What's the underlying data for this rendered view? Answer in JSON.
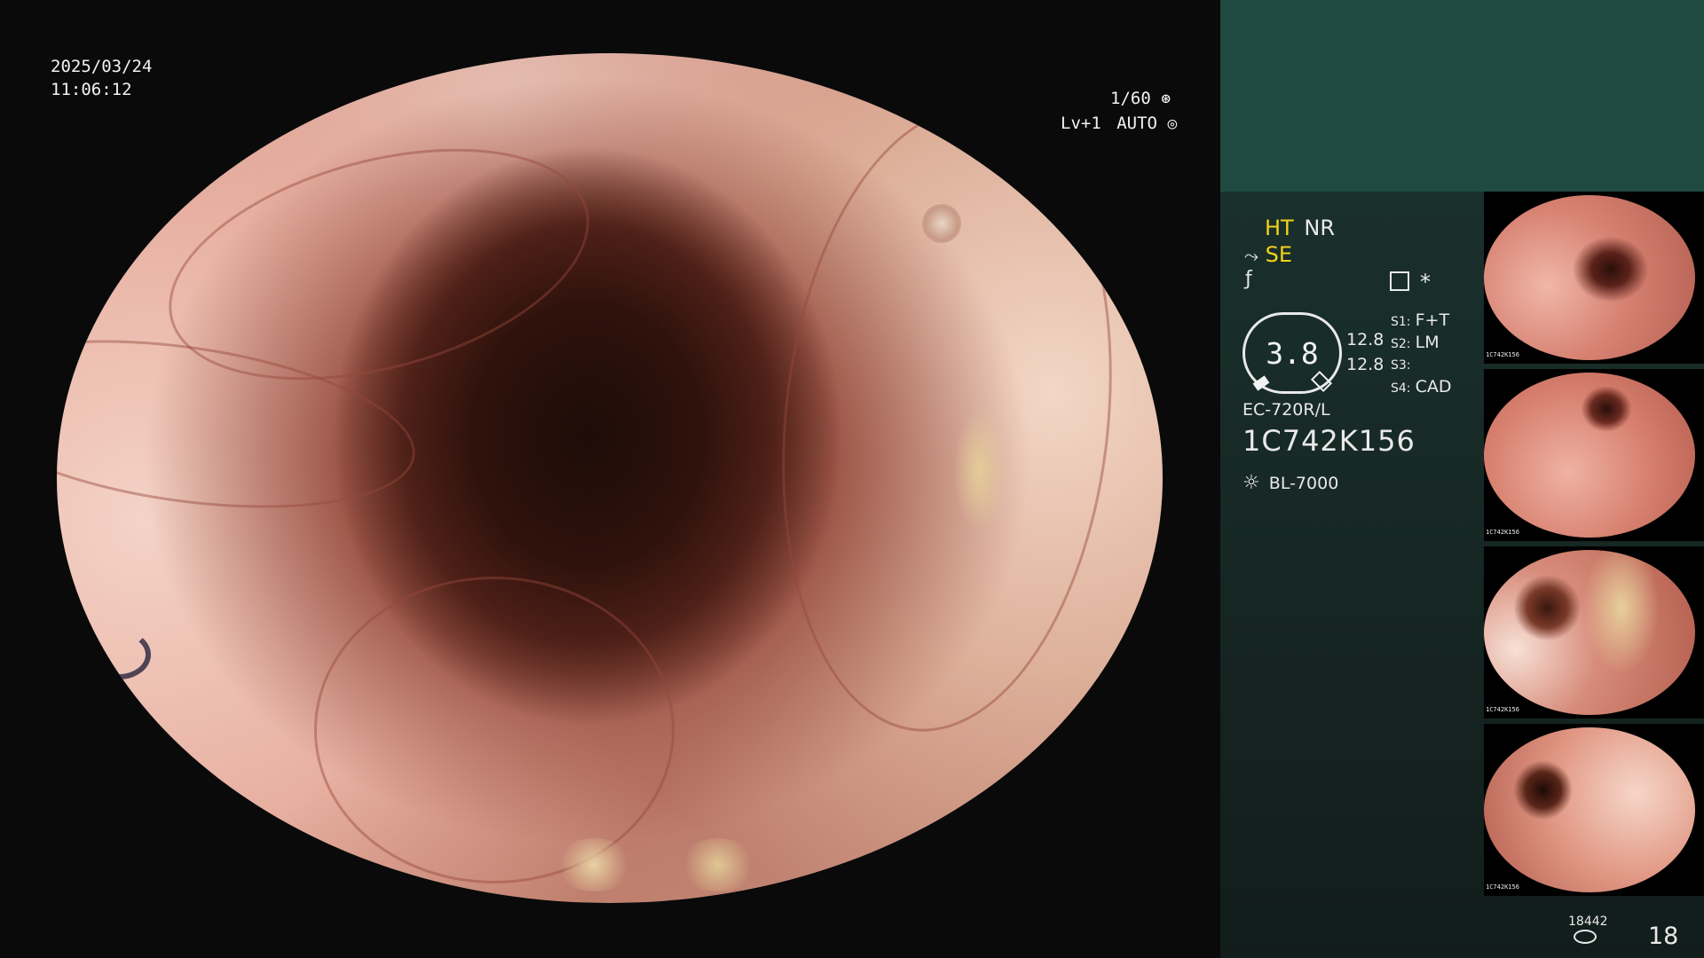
{
  "overlay": {
    "date": "2025/03/24",
    "time": "11:06:12",
    "shutter": "1/60",
    "level": "Lv+1",
    "iris": "AUTO"
  },
  "status": {
    "ht": "HT",
    "nr": "NR",
    "se": "SE",
    "gauge_value": "3.8",
    "value_top": "12.8",
    "value_bottom": "12.8",
    "s1": "S1:",
    "s1_value": "F+T",
    "s2": "S2:",
    "s2_value": "LM",
    "s3": "S3:",
    "s4": "S4:",
    "s4_value": "CAD",
    "scope_model": "EC-720R/L",
    "scope_serial": "1C742K156",
    "light_source": "BL-7000",
    "storage_count": "18442",
    "image_count": "18"
  },
  "thumbnails": [
    {
      "id": "1C742K156"
    },
    {
      "id": "1C742K156"
    },
    {
      "id": "1C742K156"
    },
    {
      "id": "1C742K156"
    }
  ],
  "colors": {
    "accent_yellow": "#f3d21a",
    "panel_top": "#1f4a42"
  }
}
